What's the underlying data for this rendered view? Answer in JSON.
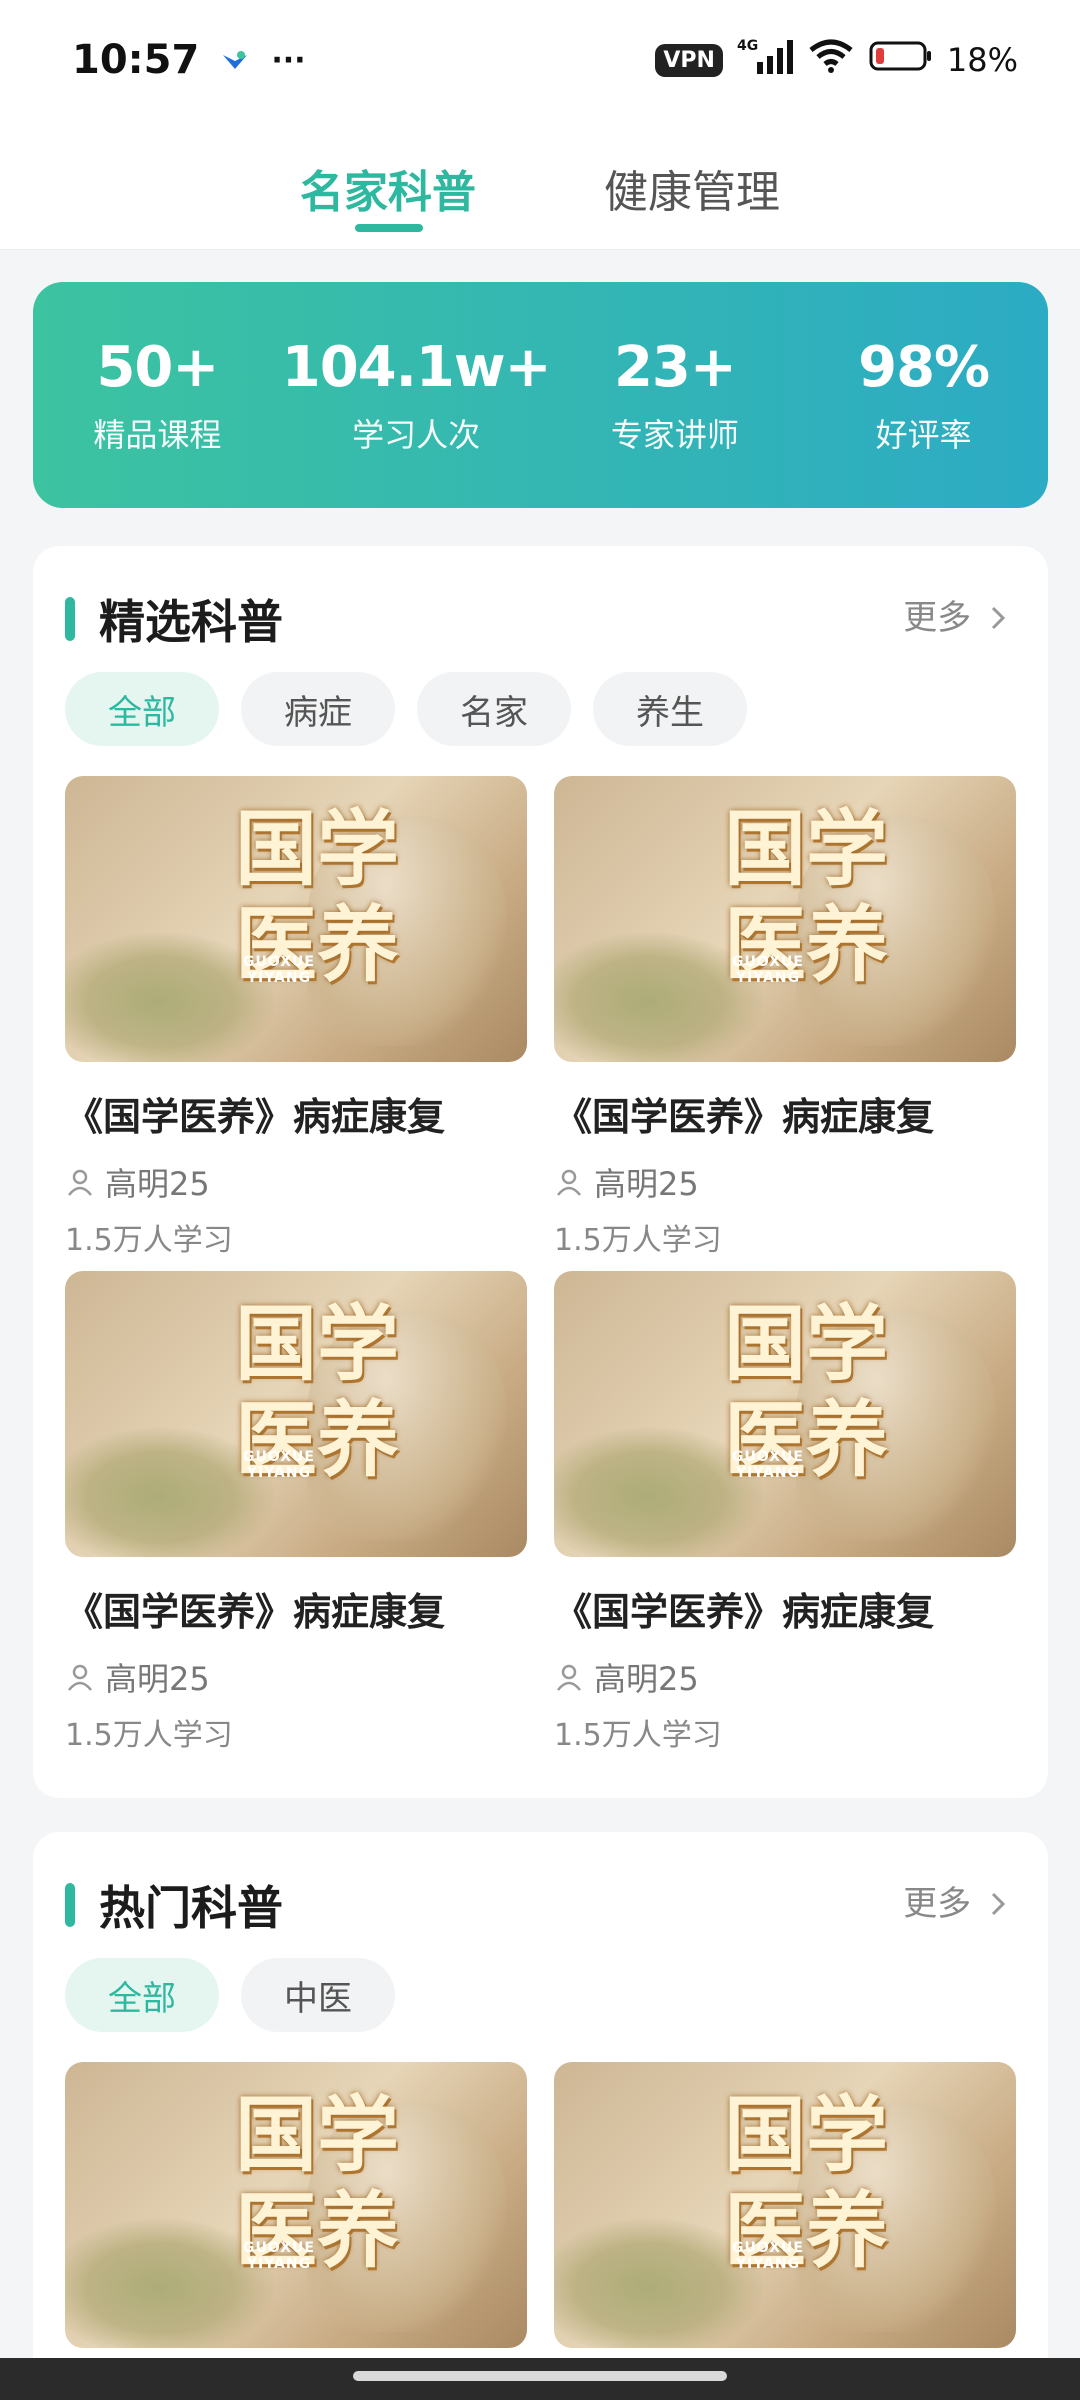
{
  "status_bar": {
    "time": "10:57",
    "dots": "···",
    "vpn": "VPN",
    "network": "4G",
    "battery": "18%"
  },
  "tabs": [
    {
      "label": "名家科普",
      "active": true
    },
    {
      "label": "健康管理",
      "active": false
    }
  ],
  "stats": [
    {
      "value": "50+",
      "label": "精品课程"
    },
    {
      "value": "104.1w+",
      "label": "学习人次"
    },
    {
      "value": "23+",
      "label": "专家讲师"
    },
    {
      "value": "98%",
      "label": "好评率"
    }
  ],
  "featured": {
    "title": "精选科普",
    "more": "更多",
    "filters": [
      "全部",
      "病症",
      "名家",
      "养生"
    ],
    "items": [
      {
        "title": "《国学医养》病症康复",
        "author": "高明25",
        "learners": "1.5万人学习"
      },
      {
        "title": "《国学医养》病症康复",
        "author": "高明25",
        "learners": "1.5万人学习"
      },
      {
        "title": "《国学医养》病症康复",
        "author": "高明25",
        "learners": "1.5万人学习"
      },
      {
        "title": "《国学医养》病症康复",
        "author": "高明25",
        "learners": "1.5万人学习"
      }
    ]
  },
  "hot": {
    "title": "热门科普",
    "more": "更多",
    "filters": [
      "全部",
      "中医"
    ]
  },
  "thumb": {
    "line1": "国学",
    "line2": "医养",
    "pinyin1": "GUOXUE",
    "pinyin2": "YIYANG"
  },
  "colors": {
    "accent": "#2fb8a0",
    "banner_start": "#3cc3a0",
    "banner_end": "#2cabc4"
  }
}
